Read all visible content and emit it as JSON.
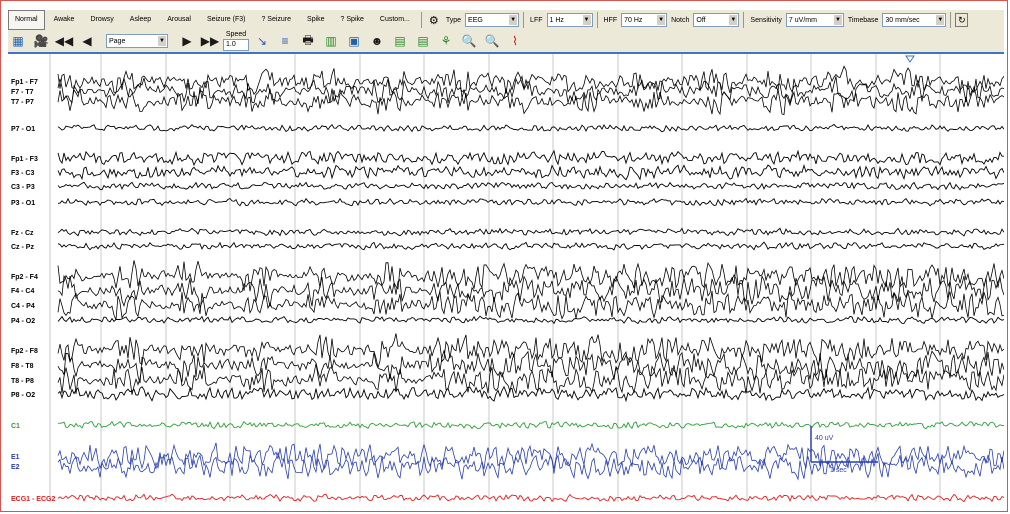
{
  "events": [
    "Normal",
    "Awake",
    "Drowsy",
    "Asleep",
    "Arousal",
    "Seizure (F3)",
    "? Seizure",
    "Spike",
    "? Spike",
    "Custom..."
  ],
  "filters": {
    "type_label": "Type",
    "type_value": "EEG",
    "lff_label": "LFF",
    "lff_value": "1 Hz",
    "hff_label": "HFF",
    "hff_value": "70 Hz",
    "notch_label": "Notch",
    "notch_value": "Off",
    "sensitivity_label": "Sensitivity",
    "sensitivity_value": "7 uV/mm",
    "timebase_label": "Timebase",
    "timebase_value": "30 mm/sec"
  },
  "nav": {
    "page_value": "Page",
    "speed_label": "Speed",
    "speed_value": "1.0"
  },
  "icons": [
    "montage-icon",
    "video-camera-icon",
    "rewind-icon",
    "step-back-icon",
    "step-forward-icon",
    "fast-forward-icon",
    "play-marker-icon",
    "stop-marker-icon",
    "print-icon",
    "columns-icon",
    "spectrum-icon",
    "search-person-icon",
    "save-montage-icon",
    "save-montage-alt-icon",
    "network-icon",
    "zoom-in-icon",
    "zoom-out-icon",
    "waveform-icon"
  ],
  "channels": [
    {
      "label": "Fp1 - F7",
      "group": "left-temporal",
      "color": "#000000",
      "amp": "high"
    },
    {
      "label": "F7 - T7",
      "group": "left-temporal",
      "color": "#000000",
      "amp": "high"
    },
    {
      "label": "T7 - P7",
      "group": "left-temporal",
      "color": "#000000",
      "amp": "high"
    },
    {
      "label": "P7 - O1",
      "group": "left-temporal",
      "color": "#000000",
      "amp": "low"
    },
    {
      "label": "Fp1 - F3",
      "group": "left-parasagittal",
      "color": "#000000",
      "amp": "mid"
    },
    {
      "label": "F3 - C3",
      "group": "left-parasagittal",
      "color": "#000000",
      "amp": "mid"
    },
    {
      "label": "C3 - P3",
      "group": "left-parasagittal",
      "color": "#000000",
      "amp": "low"
    },
    {
      "label": "P3 - O1",
      "group": "left-parasagittal",
      "color": "#000000",
      "amp": "low"
    },
    {
      "label": "Fz - Cz",
      "group": "midline",
      "color": "#000000",
      "amp": "low"
    },
    {
      "label": "Cz - Pz",
      "group": "midline",
      "color": "#000000",
      "amp": "low"
    },
    {
      "label": "Fp2 - F4",
      "group": "right-parasagittal",
      "color": "#000000",
      "amp": "high"
    },
    {
      "label": "F4 - C4",
      "group": "right-parasagittal",
      "color": "#000000",
      "amp": "high"
    },
    {
      "label": "C4 - P4",
      "group": "right-parasagittal",
      "color": "#000000",
      "amp": "high"
    },
    {
      "label": "P4 - O2",
      "group": "right-parasagittal",
      "color": "#000000",
      "amp": "low"
    },
    {
      "label": "Fp2 - F8",
      "group": "right-temporal",
      "color": "#000000",
      "amp": "high"
    },
    {
      "label": "F8 - T8",
      "group": "right-temporal",
      "color": "#000000",
      "amp": "high"
    },
    {
      "label": "T8 - P8",
      "group": "right-temporal",
      "color": "#000000",
      "amp": "high"
    },
    {
      "label": "P8 - O2",
      "group": "right-temporal",
      "color": "#000000",
      "amp": "mid"
    },
    {
      "label": "C1",
      "group": "aux",
      "color": "#2e9e3a",
      "amp": "low"
    },
    {
      "label": "E1",
      "group": "eog",
      "color": "#2a3fb0",
      "amp": "high"
    },
    {
      "label": "E2",
      "group": "eog",
      "color": "#2a3fb0",
      "amp": "high"
    },
    {
      "label": "ECG1 - ECG2",
      "group": "ecg",
      "color": "#e02020",
      "amp": "low"
    }
  ],
  "scale_bar": {
    "amplitude_label": "40 uV",
    "time_label": "1 sec"
  },
  "colors": {
    "accent_blue": "#4472c4",
    "grid": "#c8c8c8",
    "eeg": "#000000",
    "green": "#2e9e3a",
    "blue": "#2a3fb0",
    "red": "#e02020",
    "frame": "#d9534f"
  }
}
